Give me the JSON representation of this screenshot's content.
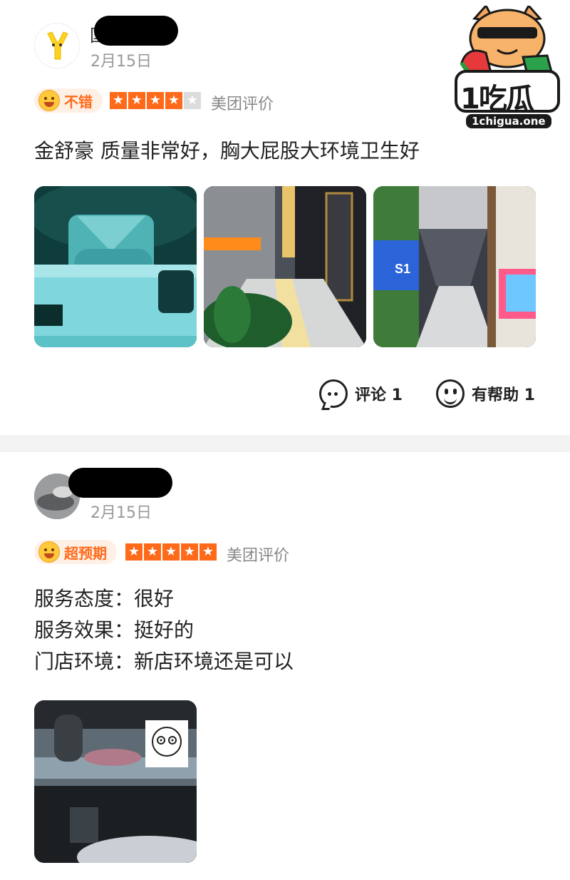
{
  "watermark": {
    "logo_text": "1吃瓜",
    "site": "1chigua.one"
  },
  "reviews": [
    {
      "name_visible_char": "国",
      "date": "2月15日",
      "badge": "不错",
      "stars": 4,
      "star_max": 5,
      "source": "美团评价",
      "text": "金舒豪 质量非常好，胸大屁股大环境卫生好",
      "photo_count": 3,
      "comment_label": "评论 1",
      "helpful_label": "有帮助 1"
    },
    {
      "name_visible_char": "",
      "date": "2月15日",
      "badge": "超预期",
      "stars": 5,
      "star_max": 5,
      "source": "美团评价",
      "lines": [
        "服务态度：很好",
        "服务效果：挺好的",
        "门店环境：新店环境还是可以"
      ],
      "photo_count": 1
    }
  ]
}
